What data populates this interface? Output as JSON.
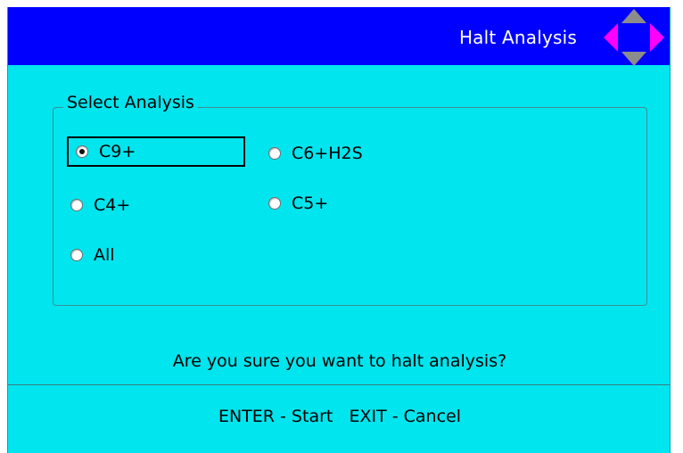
{
  "header": {
    "title": "Halt Analysis",
    "nav_icon": "direction-pad-icon",
    "colors": {
      "background": "#0000ff",
      "up_down_arrows": "#8c8c8c",
      "left_right_arrows": "#ff00ff"
    }
  },
  "analysis_group": {
    "legend": "Select Analysis",
    "options": [
      {
        "label": "C9+",
        "checked": true,
        "focused": true
      },
      {
        "label": "C6+H2S",
        "checked": false,
        "focused": false
      },
      {
        "label": "C4+",
        "checked": false,
        "focused": false
      },
      {
        "label": "C5+",
        "checked": false,
        "focused": false
      },
      {
        "label": "All",
        "checked": false,
        "focused": false
      }
    ]
  },
  "prompt": "Are you sure you want to halt analysis?",
  "footer": {
    "enter_label": "ENTER - Start",
    "exit_label": "EXIT - Cancel"
  },
  "colors": {
    "screen_background": "#00e5ee"
  }
}
